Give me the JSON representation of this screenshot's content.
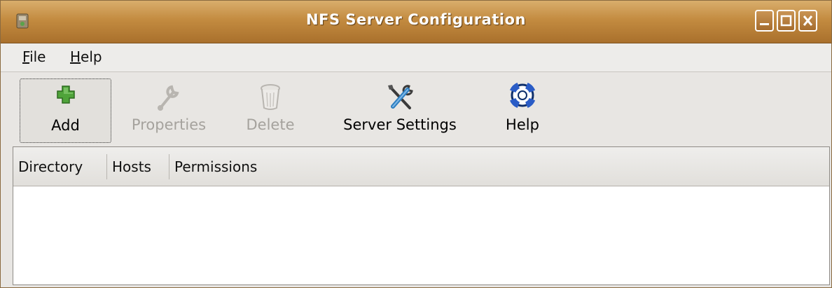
{
  "window": {
    "title": "NFS Server Configuration",
    "icon": "nfs-app-icon",
    "controls": [
      "minimize-icon",
      "maximize-icon",
      "close-icon"
    ]
  },
  "menubar": {
    "file": {
      "mnemonic": "F",
      "rest": "ile"
    },
    "help": {
      "mnemonic": "H",
      "rest": "elp"
    }
  },
  "toolbar": {
    "add": {
      "label": "Add",
      "icon": "add-icon",
      "enabled": true
    },
    "properties": {
      "label": "Properties",
      "icon": "wrench-icon",
      "enabled": false
    },
    "delete": {
      "label": "Delete",
      "icon": "trash-icon",
      "enabled": false
    },
    "server_settings": {
      "label": "Server Settings",
      "icon": "tools-icon",
      "enabled": true
    },
    "help": {
      "label": "Help",
      "icon": "lifebuoy-icon",
      "enabled": true
    }
  },
  "list": {
    "columns": [
      "Directory",
      "Hosts",
      "Permissions"
    ],
    "rows": []
  },
  "colors": {
    "titlebar": "#c38b40",
    "add_green": "#4fa33a",
    "disabled_text": "#a5a29d"
  }
}
